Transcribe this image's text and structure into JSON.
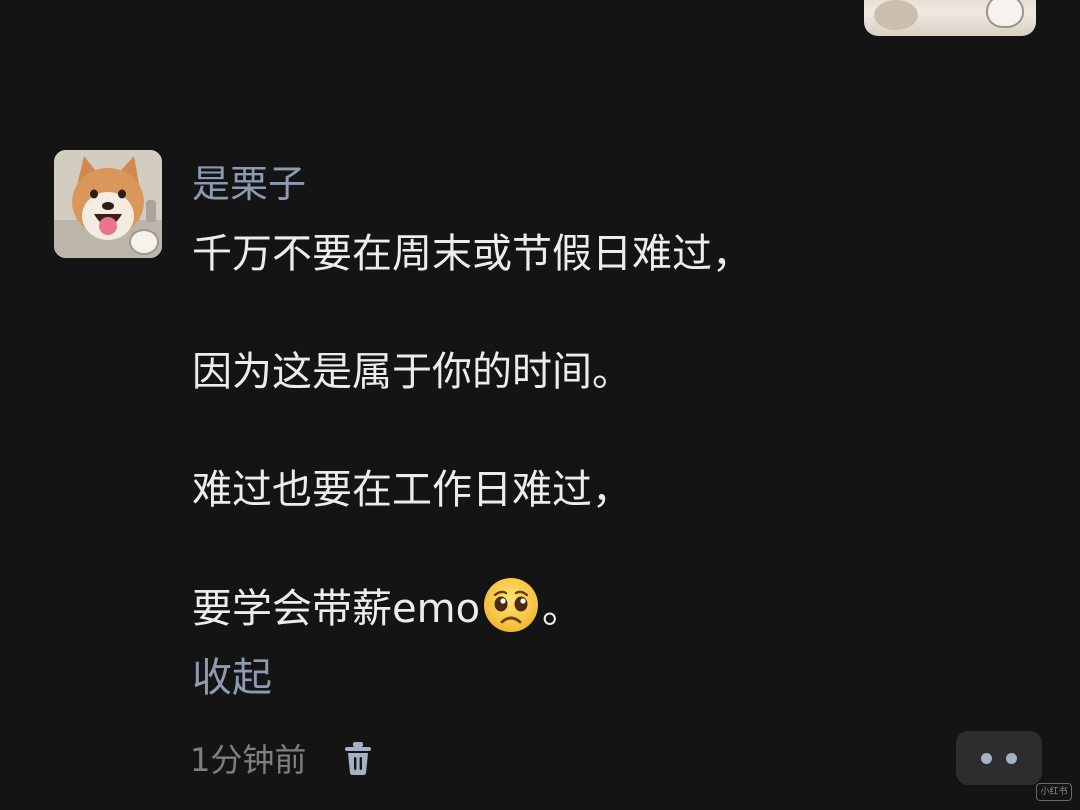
{
  "comment": {
    "username": "是栗子",
    "lines": [
      "千万不要在周末或节假日难过，",
      "因为这是属于你的时间。",
      "难过也要在工作日难过，"
    ],
    "last_line_prefix": "要学会带薪emo",
    "last_line_emoji": "pleading-face-emoji",
    "last_line_suffix": "。",
    "collapse_label": "收起",
    "timestamp": "1分钟前",
    "delete_icon": "trash-icon"
  },
  "colors": {
    "background": "#141414",
    "text": "#ececec",
    "accent": "#8e9ab0",
    "muted": "#7f7f7f",
    "more_button_bg": "#2d2d2f",
    "more_dots": "#a6b1c4"
  },
  "more_button": {
    "icon": "more-dots-icon"
  },
  "watermark": {
    "text": "小红书"
  }
}
